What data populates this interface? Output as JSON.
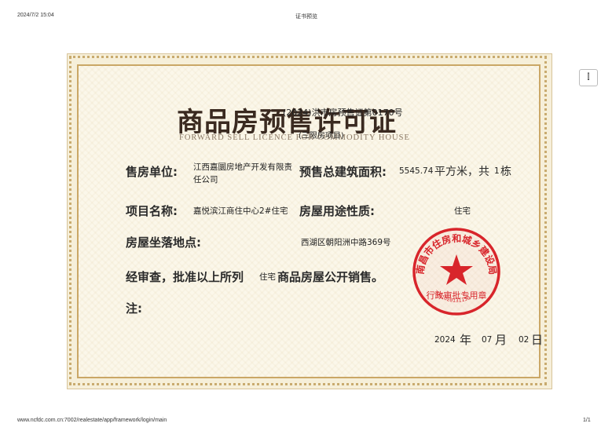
{
  "print_header": {
    "datetime": "2024/7/2 15:04",
    "page_title": "证书预览"
  },
  "print_footer": {
    "url": "www.ncfdc.com.cn:7002/realestate/app/framework/login/main",
    "page": "1/1"
  },
  "side_button_label": "⫿",
  "certificate": {
    "title": "商品房预售许可证",
    "title_en": "FORWARD SELL LICENCE FOR COMMODITY HOUSE",
    "number": "(2024)洪市房预售证第0170号",
    "restriction": "(三限房项目)",
    "seller_label": "售房单位:",
    "seller_value_line1": "江西嘉圜房地产开发有限责",
    "seller_value_line2": "任公司",
    "area_label": "预售总建筑面积:",
    "area_value": "5545.74",
    "area_unit": "平方米，共",
    "building_count": "1",
    "building_unit": "栋",
    "project_label": "项目名称:",
    "project_value": "嘉悦滨江商住中心2#住宅",
    "usage_label": "房屋用途性质:",
    "usage_value": "住宅",
    "location_label": "房屋坐落地点:",
    "location_value": "西湖区朝阳洲中路369号",
    "approval_prefix": "经审查，批准以上所列",
    "approval_type": "住宅",
    "approval_suffix": "商品房屋公开销售。",
    "note_label": "注:",
    "date_year": "2024",
    "date_year_unit": "年",
    "date_month": "07",
    "date_month_unit": "月",
    "date_day": "02",
    "date_day_unit": "日",
    "stamp": {
      "outer_text": "南昌市住房和城乡建设局",
      "inner_text": "行政审批专用章",
      "code": "3601020131150",
      "color": "#d8252b"
    }
  }
}
